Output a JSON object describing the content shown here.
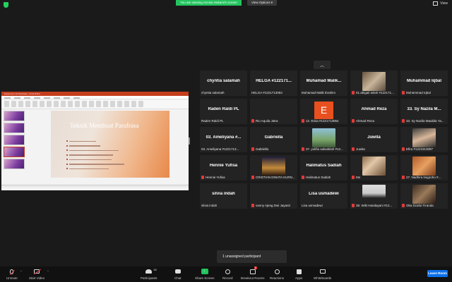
{
  "top_bar": {
    "banner": "You are viewing Annisa Hukami's screen",
    "view_options": "View Options ▾",
    "view_mode": "View"
  },
  "shared_screen": {
    "app_title": "Pertemuan 12 Parafrasa - PowerPoint",
    "account": "",
    "slide_title": "Teknik Membuat Parafrasa",
    "slide_bullets": 7,
    "thumbnails": 5
  },
  "gallery": {
    "scroll_up": "︿",
    "tiles": [
      {
        "title": "chyntia salamah",
        "label": "chyntia salamah",
        "muted": false,
        "video": null
      },
      {
        "title": "HELGA #122171...",
        "label": "HELGA #1221713063",
        "muted": false,
        "video": null
      },
      {
        "title": "Muhamad Malik...",
        "label": "Muhamad Malik Ibrahim",
        "muted": false,
        "video": null
      },
      {
        "title": "",
        "label": "01.abigail aslah #122171...",
        "muted": true,
        "video": "photo-indoor"
      },
      {
        "title": "Muhammad Iqbal",
        "label": "Muhammad Iqbal",
        "muted": true,
        "video": null
      },
      {
        "title": "Raden Raldi PL",
        "label": "Raden Raldi PL",
        "muted": false,
        "video": null
      },
      {
        "title": "",
        "label": "Rio Aquila Jatra",
        "muted": true,
        "video": null
      },
      {
        "title": "",
        "label": "12. Erisa #1221713064",
        "muted": true,
        "video": "letter",
        "letter": "E"
      },
      {
        "title": "Ahmad Reza",
        "label": "Ahmad Reza",
        "muted": true,
        "video": null
      },
      {
        "title": "33. Sy Nazila M...",
        "label": "33. Sy Nazila Maulida Ya...",
        "muted": true,
        "video": null
      },
      {
        "title": "03. Ameliyana #...",
        "label": "03. Ameliyana #1221713...",
        "muted": false,
        "video": null
      },
      {
        "title": "Gabriella",
        "label": "Gabriella",
        "muted": true,
        "video": null
      },
      {
        "title": "",
        "label": "37. yulifia salsabilah #12...",
        "muted": true,
        "video": "photo-outdoor"
      },
      {
        "title": "Juwita",
        "label": "Juwita",
        "muted": true,
        "video": null
      },
      {
        "title": "",
        "label": "Efira #1221913097",
        "muted": true,
        "video": "photo-person"
      },
      {
        "title": "Hennie Yufisa",
        "label": "Hennie Yufisa",
        "muted": true,
        "video": null
      },
      {
        "title": "",
        "label": "CRISTIAN DINATA KURN...",
        "muted": true,
        "video": "photo-night"
      },
      {
        "title": "Halimatus Sadiah",
        "label": "Halimatus Sadiah",
        "muted": true,
        "video": null
      },
      {
        "title": "",
        "label": "Mo",
        "muted": true,
        "video": "photo-group"
      },
      {
        "title": "",
        "label": "27. Nadhira Nugroho #...",
        "muted": true,
        "video": "photo-warm"
      },
      {
        "title": "silvia indah",
        "label": "silvia indah",
        "muted": false,
        "video": null
      },
      {
        "title": "",
        "label": "vanny Ajeng Dwi Jayanti",
        "muted": true,
        "video": null
      },
      {
        "title": "Lisa usmadewi",
        "label": "Lisa usmadewi",
        "muted": false,
        "video": null
      },
      {
        "title": "",
        "label": "38. Wiki Handayani #12...",
        "muted": true,
        "video": "photo-hijab"
      },
      {
        "title": "",
        "label": "Oka Dzaful Firanda",
        "muted": true,
        "video": "photo-dark"
      }
    ]
  },
  "unassigned": "1 unassigned participant",
  "toolbar": {
    "unmute": "Unmute",
    "start_video": "Start Video",
    "participants": "Participants",
    "participants_count": "38",
    "chat": "Chat",
    "share_screen": "Share Screen",
    "record": "Record",
    "breakout_rooms": "Breakout Rooms",
    "breakout_badge": "1",
    "reactions": "Reactions",
    "apps": "Apps",
    "whiteboards": "Whiteboards",
    "leave": "Leave Room"
  },
  "colors": {
    "green": "#23c45e",
    "mute_red": "#e23a3a",
    "leave_blue": "#0e71eb",
    "ppt_red": "#c43e1c",
    "letter_tile": "#e8501f"
  }
}
